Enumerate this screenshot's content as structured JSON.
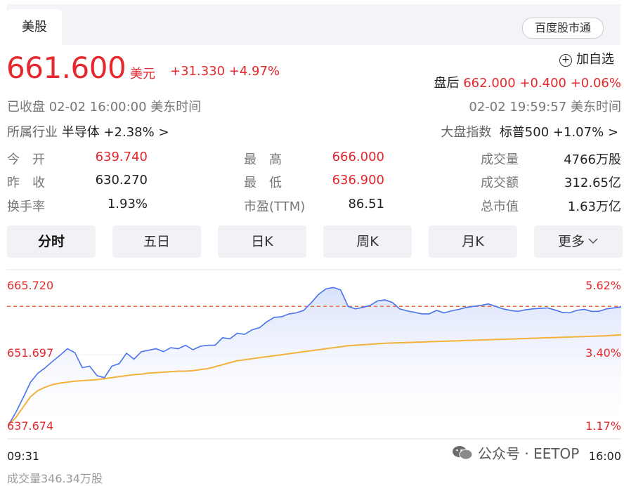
{
  "tab": {
    "label": "美股"
  },
  "baidu_button": "百度股市通",
  "quote": {
    "price": "661.600",
    "currency": "美元",
    "change": "+31.330 +4.97%",
    "status": "已收盘 02-02 16:00:00 美东时间",
    "add_watch": "加自选",
    "after_hours_label": "盘后",
    "after_hours_value": "662.000 +0.400 +0.06%",
    "after_hours_time": "02-02 19:59:57 美东时间"
  },
  "industry": {
    "label": "所属行业",
    "name": "半导体",
    "change": "+2.38%",
    "arrow": ">"
  },
  "index": {
    "label": "大盘指数",
    "name": "标普500",
    "change": "+1.07%",
    "arrow": ">"
  },
  "stats": [
    {
      "label": "今　开",
      "value": "639.740",
      "color": "red"
    },
    {
      "label": "最　高",
      "value": "666.000",
      "color": "red"
    },
    {
      "label": "成交量",
      "value": "4766万股",
      "color": "dark"
    },
    {
      "label": "昨　收",
      "value": "630.270",
      "color": "dark"
    },
    {
      "label": "最　低",
      "value": "636.900",
      "color": "red"
    },
    {
      "label": "成交额",
      "value": "312.65亿",
      "color": "dark"
    },
    {
      "label": "换手率",
      "value": "1.93%",
      "color": "dark"
    },
    {
      "label": "市盈(TTM)",
      "value": "86.51",
      "color": "dark"
    },
    {
      "label": "总市值",
      "value": "1.63万亿",
      "color": "dark"
    }
  ],
  "period_tabs": [
    "分时",
    "五日",
    "日K",
    "周K",
    "月K",
    "更多"
  ],
  "colors": {
    "up": "#e5282d",
    "price_line": "#4a73ee",
    "avg_line": "#f3b23c",
    "fill_top": "#dbe3fb",
    "ref_line": "#f06a35"
  },
  "chart_data": {
    "type": "line",
    "y_labels_left": [
      "665.720",
      "651.697",
      "637.674"
    ],
    "y_labels_right": [
      "5.62%",
      "3.40%",
      "1.17%"
    ],
    "x_labels": [
      "09:31",
      "16:00"
    ],
    "ylim": [
      637.674,
      665.72
    ],
    "reference_value": 661.6,
    "series": [
      {
        "values": [
          637.8,
          640.3,
          643.3,
          646.4,
          648.2,
          649.3,
          650.6,
          651.8,
          653.1,
          652.3,
          649.3,
          649.6,
          647.7,
          647.3,
          649.6,
          650.1,
          652.2,
          651.0,
          652.5,
          652.8,
          653.1,
          652.5,
          653.3,
          653.1,
          653.8,
          652.9,
          653.6,
          653.8,
          653.8,
          655.3,
          655.1,
          656.2,
          656.0,
          656.9,
          657.3,
          658.5,
          659.4,
          659.5,
          660.1,
          660.3,
          660.8,
          662.3,
          664.0,
          665.1,
          665.4,
          664.9,
          661.6,
          661.1,
          661.4,
          661.8,
          662.7,
          662.9,
          662.4,
          661.1,
          660.7,
          660.4,
          660.1,
          660.1,
          660.8,
          660.3,
          660.7,
          661.0,
          661.4,
          661.6,
          661.8,
          662.1,
          661.6,
          661.1,
          660.8,
          660.6,
          660.9,
          661.1,
          661.2,
          661.3,
          660.9,
          660.4,
          660.3,
          660.8,
          661.0,
          660.6,
          660.6,
          661.1,
          661.3,
          661.5
        ],
        "legend": false
      },
      {
        "values": [
          637.8,
          639.3,
          641.4,
          643.5,
          644.7,
          645.4,
          645.9,
          646.2,
          646.4,
          646.6,
          646.7,
          646.8,
          646.9,
          647.1,
          647.3,
          647.5,
          647.7,
          647.9,
          648.0,
          648.2,
          648.3,
          648.4,
          648.5,
          648.6,
          648.6,
          648.7,
          648.9,
          649.1,
          649.5,
          649.9,
          650.3,
          650.7,
          650.9,
          651.1,
          651.3,
          651.5,
          651.7,
          651.9,
          652.1,
          652.3,
          652.5,
          652.7,
          652.9,
          653.1,
          653.3,
          653.5,
          653.7,
          653.8,
          653.9,
          654.0,
          654.1,
          654.2,
          654.25,
          654.3,
          654.35,
          654.4,
          654.45,
          654.5,
          654.55,
          654.6,
          654.65,
          654.7,
          654.75,
          654.8,
          654.85,
          654.9,
          654.95,
          655.0,
          655.05,
          655.1,
          655.15,
          655.2,
          655.25,
          655.3,
          655.35,
          655.4,
          655.45,
          655.5,
          655.55,
          655.6,
          655.65,
          655.7,
          655.8,
          655.9
        ],
        "legend": false
      }
    ]
  },
  "watermark": "公众号 · EETOP",
  "bottom_cut": "成交量346.34万股"
}
